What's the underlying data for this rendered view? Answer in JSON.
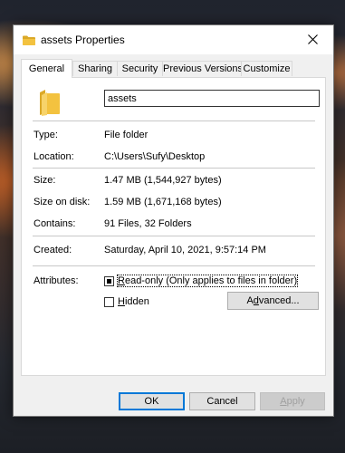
{
  "window": {
    "title": "assets Properties"
  },
  "tabs": [
    {
      "label": "General",
      "active": true
    },
    {
      "label": "Sharing",
      "active": false
    },
    {
      "label": "Security",
      "active": false
    },
    {
      "label": "Previous Versions",
      "active": false
    },
    {
      "label": "Customize",
      "active": false
    }
  ],
  "general": {
    "name": "assets",
    "type": {
      "label": "Type:",
      "value": "File folder"
    },
    "location": {
      "label": "Location:",
      "value": "C:\\Users\\Sufy\\Desktop"
    },
    "size": {
      "label": "Size:",
      "value": "1.47 MB (1,544,927 bytes)"
    },
    "size_on_disk": {
      "label": "Size on disk:",
      "value": "1.59 MB (1,671,168 bytes)"
    },
    "contains": {
      "label": "Contains:",
      "value": "91 Files, 32 Folders"
    },
    "created": {
      "label": "Created:",
      "value": "Saturday, April 10, 2021, 9:57:14 PM"
    },
    "attributes": {
      "label": "Attributes:",
      "readonly": {
        "label_hotkey": "R",
        "label_rest": "ead-only (Only applies to files in folder)",
        "state": "indeterminate"
      },
      "hidden": {
        "label_hotkey": "H",
        "label_rest": "idden",
        "checked": false
      },
      "advanced": {
        "label_pre": "A",
        "label_hotkey": "d",
        "label_rest": "vanced..."
      }
    }
  },
  "buttons": {
    "ok": "OK",
    "cancel": "Cancel",
    "apply_hotkey": "A",
    "apply_rest": "pply"
  },
  "colors": {
    "folder": "#f3c23f",
    "folder_dark": "#dba928",
    "accent": "#0078d7"
  }
}
